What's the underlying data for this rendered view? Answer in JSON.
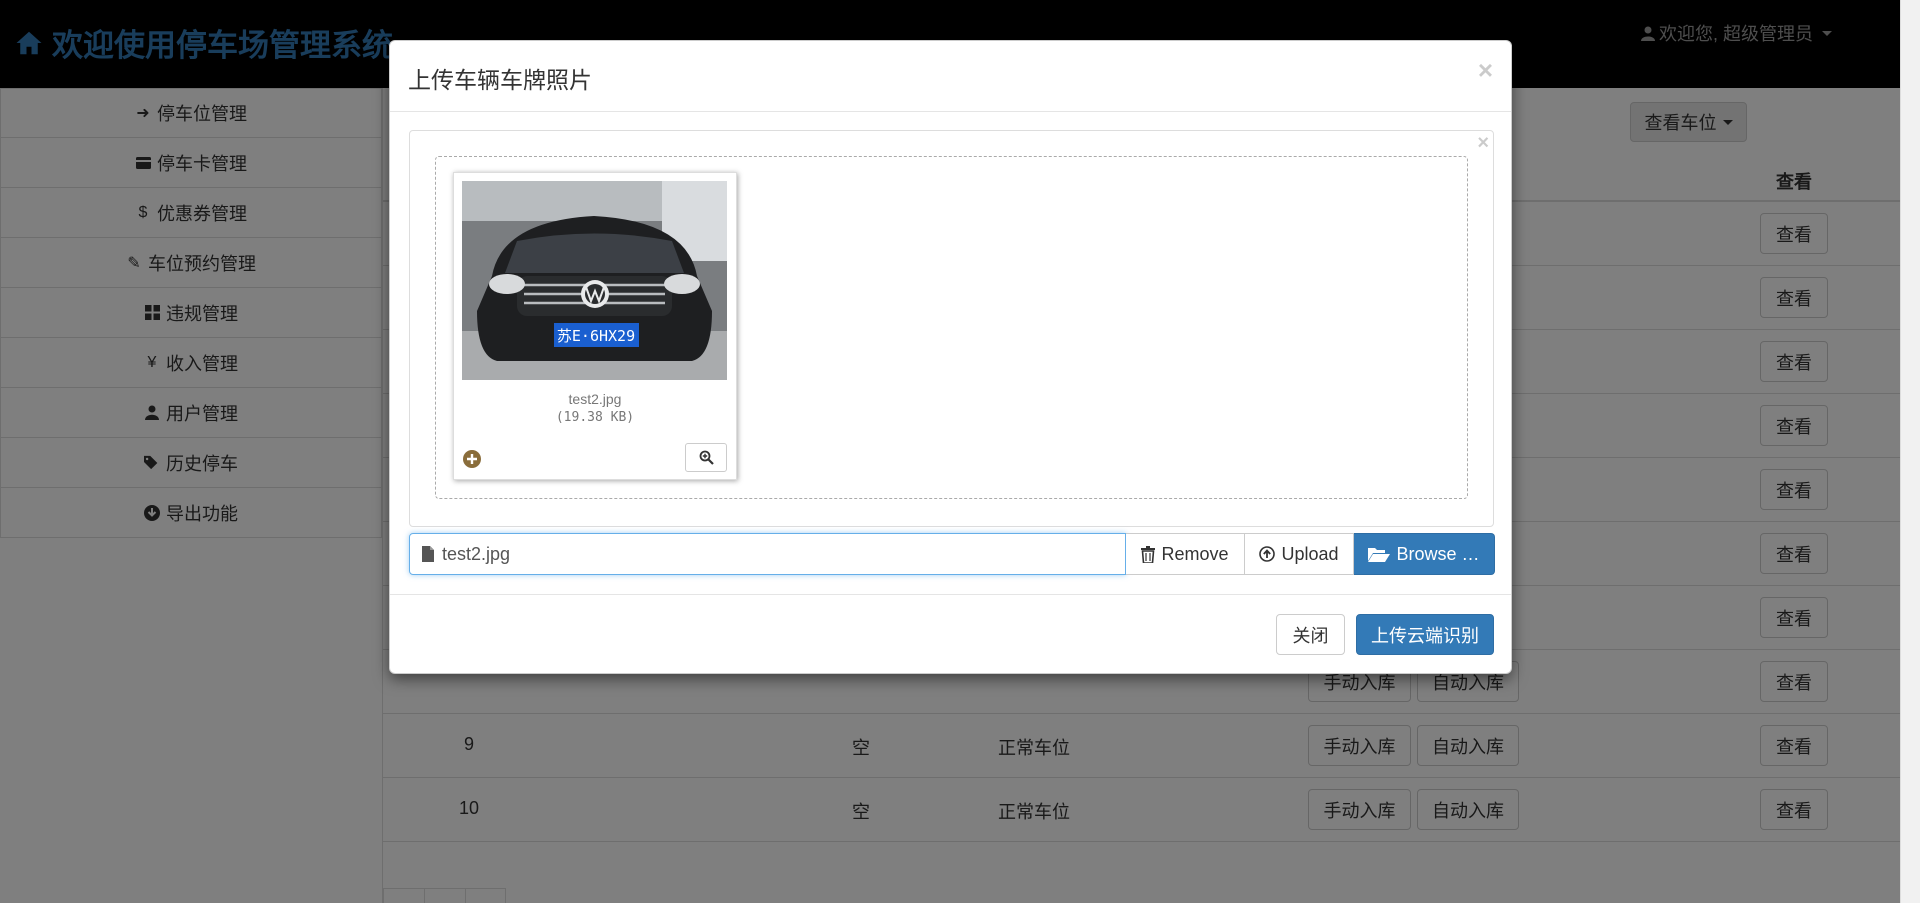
{
  "header": {
    "brand": "欢迎使用停车场管理系统",
    "user_greeting": "欢迎您, 超级管理员"
  },
  "sidebar": {
    "items": [
      {
        "label": "停车位管理",
        "icon": "log-in-icon"
      },
      {
        "label": "停车卡管理",
        "icon": "credit-card-icon"
      },
      {
        "label": "优惠券管理",
        "icon": "dollar-icon"
      },
      {
        "label": "车位预约管理",
        "icon": "pushpin-icon"
      },
      {
        "label": "违规管理",
        "icon": "th-large-icon"
      },
      {
        "label": "收入管理",
        "icon": "yen-icon"
      },
      {
        "label": "用户管理",
        "icon": "user-icon"
      },
      {
        "label": "历史停车",
        "icon": "tags-icon"
      },
      {
        "label": "导出功能",
        "icon": "download-icon"
      }
    ]
  },
  "main": {
    "view_dropdown": "查看车位",
    "col_view": "查看",
    "rows": [
      {
        "num": "",
        "status": "",
        "type": "",
        "view": "查看"
      },
      {
        "num": "",
        "status": "",
        "type": "",
        "view": "查看"
      },
      {
        "num": "",
        "status": "",
        "type": "",
        "view": "查看"
      },
      {
        "num": "",
        "status": "",
        "type": "",
        "view": "查看"
      },
      {
        "num": "",
        "status": "",
        "type": "",
        "view": "查看"
      },
      {
        "num": "",
        "status": "",
        "type": "",
        "view": "查看"
      },
      {
        "num": "",
        "status": "",
        "type": "",
        "view": "查看"
      },
      {
        "num": "",
        "status": "",
        "type": "",
        "manual": "手动入库",
        "auto": "自动入库",
        "view": "查看"
      },
      {
        "num": "9",
        "status": "空",
        "type": "正常车位",
        "manual": "手动入库",
        "auto": "自动入库",
        "view": "查看"
      },
      {
        "num": "10",
        "status": "空",
        "type": "正常车位",
        "manual": "手动入库",
        "auto": "自动入库",
        "view": "查看"
      }
    ]
  },
  "modal": {
    "title": "上传车辆车牌照片",
    "file_name": "test2.jpg",
    "file_size": "(19.38 KB)",
    "plate_text": "苏E·6HX29",
    "caption_value": "test2.jpg",
    "remove_label": "Remove",
    "upload_label": "Upload",
    "browse_label": "Browse …",
    "close_label": "关闭",
    "submit_label": "上传云端识别"
  }
}
